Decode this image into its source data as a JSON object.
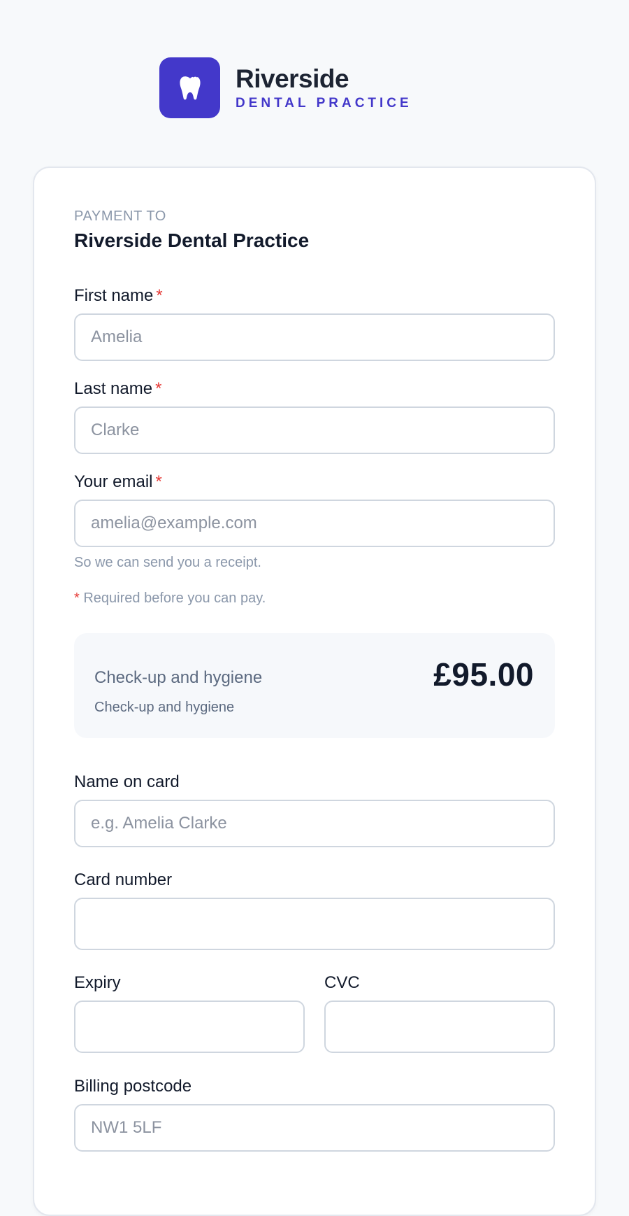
{
  "brand": {
    "name": "Riverside",
    "subtitle": "DENTAL PRACTICE",
    "logo_icon": "tooth-icon",
    "accent_color": "#4338ca"
  },
  "payment": {
    "eyebrow": "PAYMENT TO",
    "payee": "Riverside Dental Practice"
  },
  "form": {
    "required_marker": "*",
    "first_name": {
      "label": "First name",
      "placeholder": "Amelia",
      "value": ""
    },
    "last_name": {
      "label": "Last name",
      "placeholder": "Clarke",
      "value": ""
    },
    "email": {
      "label": "Your email",
      "placeholder": "amelia@example.com",
      "value": "",
      "hint": "So we can send you a receipt."
    },
    "required_note": "Required before you can pay."
  },
  "summary": {
    "title": "Check-up and hygiene",
    "description": "Check-up and hygiene",
    "amount": "£95.00"
  },
  "card": {
    "name_on_card": {
      "label": "Name on card",
      "placeholder": "e.g. Amelia Clarke"
    },
    "card_number": {
      "label": "Card number"
    },
    "expiry": {
      "label": "Expiry"
    },
    "cvc": {
      "label": "CVC"
    },
    "postcode": {
      "label": "Billing postcode",
      "placeholder": "NW1 5LF"
    }
  },
  "colors": {
    "required": "#e53935",
    "background": "#f7f9fb",
    "border": "#cfd6df"
  }
}
